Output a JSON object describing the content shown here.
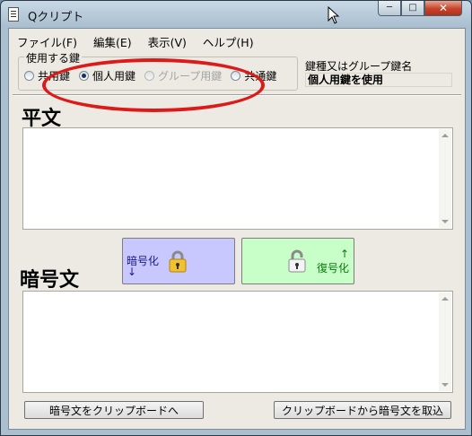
{
  "window": {
    "title": "Qクリプト"
  },
  "caption_buttons": {
    "minimize": "─",
    "maximize": "□",
    "close": "✕"
  },
  "menu": [
    "ファイル(F)",
    "編集(E)",
    "表示(V)",
    "ヘルプ(H)"
  ],
  "key_group": {
    "legend": "使用する鍵",
    "options": [
      {
        "label": "共用鍵",
        "selected": false,
        "enabled": true
      },
      {
        "label": "個人用鍵",
        "selected": true,
        "enabled": true
      },
      {
        "label": "グループ用鍵",
        "selected": false,
        "enabled": false
      },
      {
        "label": "共通鍵",
        "selected": false,
        "enabled": true
      }
    ]
  },
  "key_type": {
    "label": "鍵種又はグループ鍵名",
    "value": "個人用鍵を使用"
  },
  "plaintext": {
    "heading": "平文",
    "value": ""
  },
  "encrypt_button": {
    "label": "暗号化",
    "arrow": "↓",
    "icon": "lock-closed-icon",
    "color": "#c8c8ff"
  },
  "decrypt_button": {
    "label": "復号化",
    "arrow": "↑",
    "icon": "lock-open-icon",
    "color": "#c8ffc8"
  },
  "ciphertext": {
    "heading": "暗号文",
    "value": ""
  },
  "bottom_buttons": {
    "copy_to_clipboard": "暗号文をクリップボードへ",
    "paste_from_clipboard": "クリップボードから暗号文を取込"
  },
  "annotation": {
    "color": "#dd1a1a"
  }
}
